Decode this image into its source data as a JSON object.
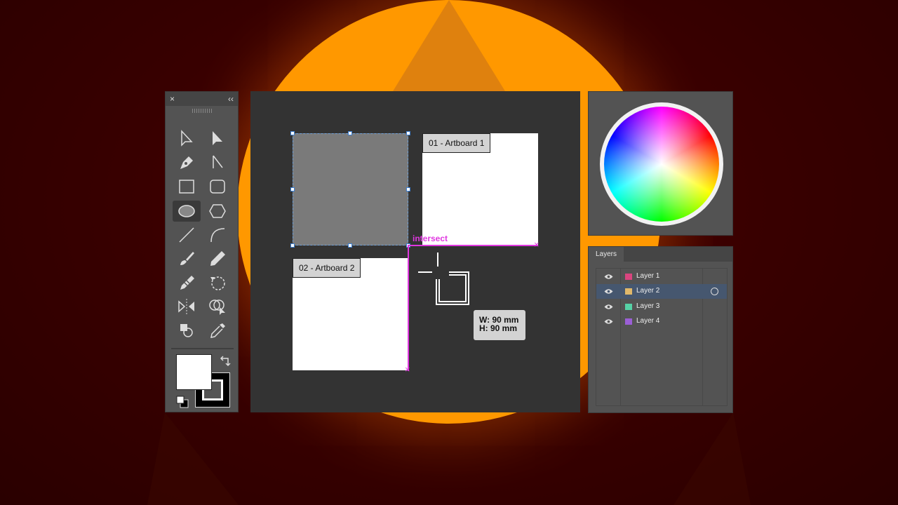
{
  "tools_panel": {
    "close_label": "×",
    "collapse_label": "‹‹",
    "tools": [
      {
        "name": "selection-tool-icon"
      },
      {
        "name": "direct-selection-tool-icon"
      },
      {
        "name": "pen-tool-icon"
      },
      {
        "name": "anchor-point-tool-icon"
      },
      {
        "name": "rectangle-tool-icon"
      },
      {
        "name": "rounded-rectangle-tool-icon"
      },
      {
        "name": "ellipse-tool-icon",
        "active": true
      },
      {
        "name": "polygon-tool-icon"
      },
      {
        "name": "line-segment-tool-icon"
      },
      {
        "name": "arc-tool-icon"
      },
      {
        "name": "paintbrush-tool-icon"
      },
      {
        "name": "pencil-tool-icon"
      },
      {
        "name": "blob-brush-tool-icon"
      },
      {
        "name": "rotate-tool-icon"
      },
      {
        "name": "reflect-tool-icon"
      },
      {
        "name": "shape-builder-tool-icon"
      },
      {
        "name": "live-paint-bucket-tool-icon"
      },
      {
        "name": "eyedropper-tool-icon"
      }
    ],
    "fill_color": "#ffffff",
    "stroke_color": "#000000"
  },
  "canvas": {
    "artboards": [
      {
        "label": "01 - Artboard 1"
      },
      {
        "label": "02 - Artboard 2"
      }
    ],
    "smart_guide_label": "intersect",
    "smart_guide_color": "#e038e0",
    "dimensions": {
      "width": "W: 90 mm",
      "height": "H: 90 mm"
    }
  },
  "layers_panel": {
    "tab_label": "Layers",
    "layers": [
      {
        "name": "Layer 1",
        "color": "#d9457f",
        "selected": false
      },
      {
        "name": "Layer 2",
        "color": "#e0b86a",
        "selected": true
      },
      {
        "name": "Layer 3",
        "color": "#56d1a6",
        "selected": false
      },
      {
        "name": "Layer 4",
        "color": "#9b5fd6",
        "selected": false
      }
    ]
  }
}
